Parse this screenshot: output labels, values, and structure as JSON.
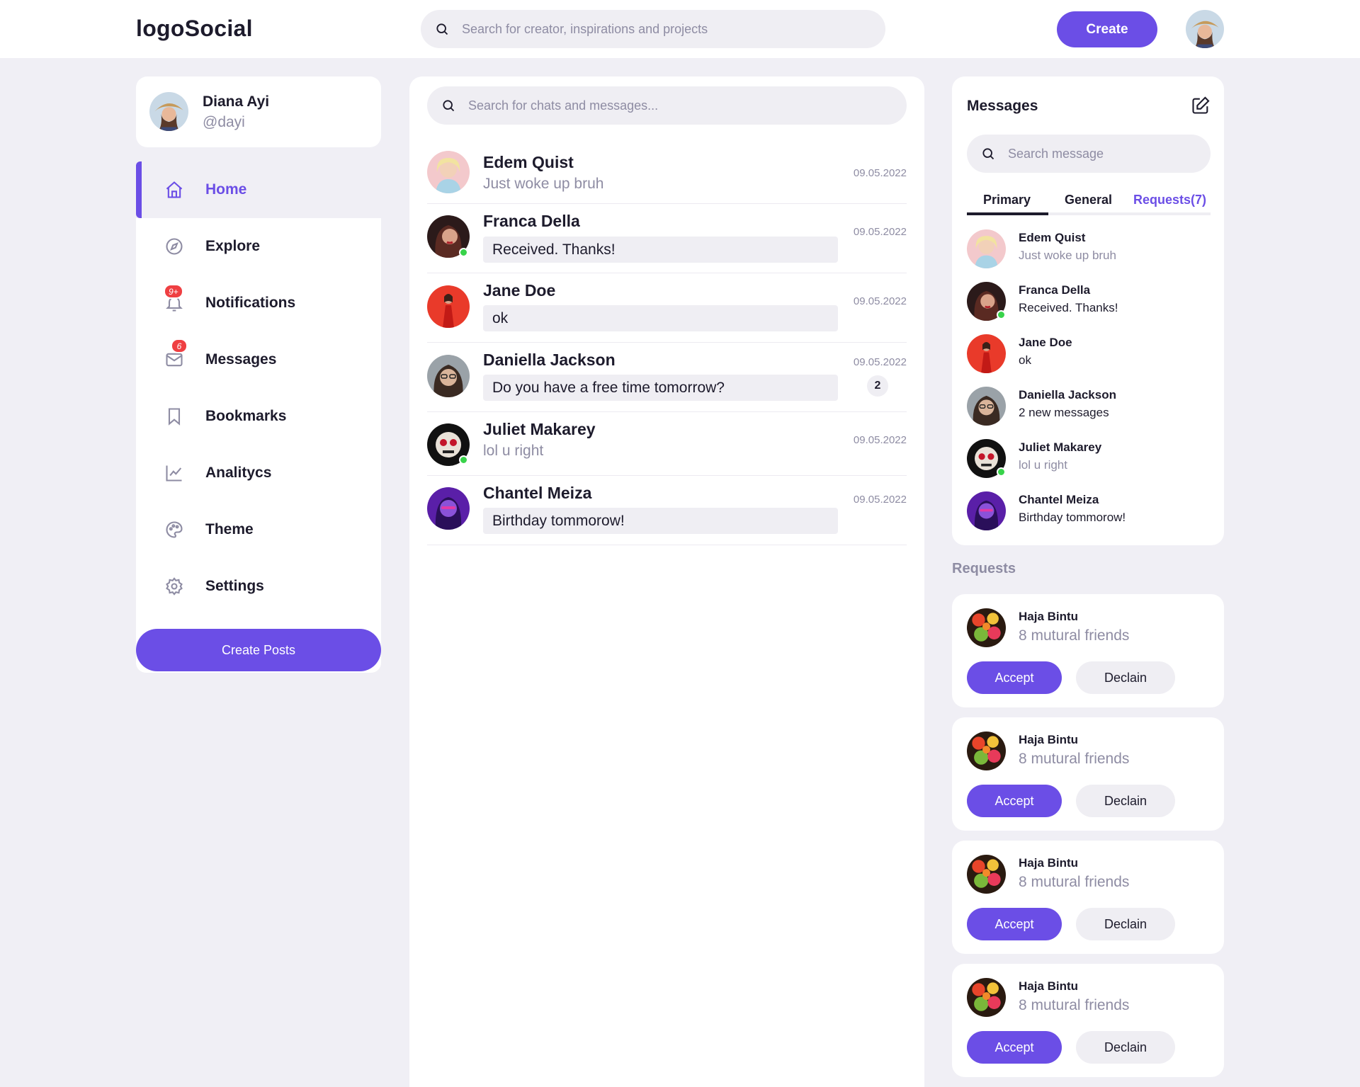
{
  "header": {
    "logo": "logoSocial",
    "search_placeholder": "Search for creator, inspirations and projects",
    "create_label": "Create"
  },
  "profile": {
    "name": "Diana Ayi",
    "handle": "@dayi"
  },
  "nav": {
    "items": [
      {
        "label": "Home",
        "icon": "home-icon",
        "active": true
      },
      {
        "label": "Explore",
        "icon": "compass-icon"
      },
      {
        "label": "Notifications",
        "icon": "bell-icon",
        "badge": "9+"
      },
      {
        "label": "Messages",
        "icon": "envelope-icon",
        "badge": "6"
      },
      {
        "label": "Bookmarks",
        "icon": "bookmark-icon"
      },
      {
        "label": "Analitycs",
        "icon": "chart-icon"
      },
      {
        "label": "Theme",
        "icon": "palette-icon"
      },
      {
        "label": "Settings",
        "icon": "gear-icon"
      }
    ],
    "create_posts_label": "Create Posts"
  },
  "chat": {
    "search_placeholder": "Search for chats and messages...",
    "rows": [
      {
        "name": "Edem Quist",
        "message": "Just woke up bruh",
        "date": "09.05.2022",
        "highlight": false,
        "online": false
      },
      {
        "name": "Franca Della",
        "message": "Received. Thanks!",
        "date": "09.05.2022",
        "highlight": true,
        "online": true
      },
      {
        "name": "Jane Doe",
        "message": "ok",
        "date": "09.05.2022",
        "highlight": true,
        "online": false
      },
      {
        "name": "Daniella Jackson",
        "message": "Do you have a free time tomorrow?",
        "date": "09.05.2022",
        "highlight": true,
        "count": "2",
        "online": false
      },
      {
        "name": "Juliet Makarey",
        "message": "lol u right",
        "date": "09.05.2022",
        "highlight": false,
        "online": true
      },
      {
        "name": "Chantel Meiza",
        "message": "Birthday tommorow!",
        "date": "09.05.2022",
        "highlight": true,
        "online": false
      }
    ]
  },
  "messages": {
    "title": "Messages",
    "search_placeholder": "Search message",
    "tabs": [
      "Primary",
      "General",
      "Requests(7)"
    ],
    "rows": [
      {
        "name": "Edem Quist",
        "text": "Just woke up bruh",
        "muted": true
      },
      {
        "name": "Franca Della",
        "text": "Received. Thanks!",
        "muted": false
      },
      {
        "name": "Jane Doe",
        "text": "ok",
        "muted": false
      },
      {
        "name": "Daniella Jackson",
        "text": "2 new messages",
        "muted": false
      },
      {
        "name": "Juliet Makarey",
        "text": "lol u right",
        "muted": true
      },
      {
        "name": "Chantel Meiza",
        "text": "Birthday tommorow!",
        "muted": false
      }
    ]
  },
  "requests": {
    "heading": "Requests",
    "items": [
      {
        "name": "Haja Bintu",
        "mutual": "8 mutural friends",
        "accept": "Accept",
        "decline": "Declain"
      },
      {
        "name": "Haja Bintu",
        "mutual": "8 mutural friends",
        "accept": "Accept",
        "decline": "Declain"
      },
      {
        "name": "Haja Bintu",
        "mutual": "8 mutural friends",
        "accept": "Accept",
        "decline": "Declain"
      },
      {
        "name": "Haja Bintu",
        "mutual": "8 mutural friends",
        "accept": "Accept",
        "decline": "Declain"
      }
    ]
  },
  "colors": {
    "accent": "#6b4ee6",
    "background": "#f0eff5",
    "online": "#38d34a",
    "badge": "#ef3f42"
  }
}
